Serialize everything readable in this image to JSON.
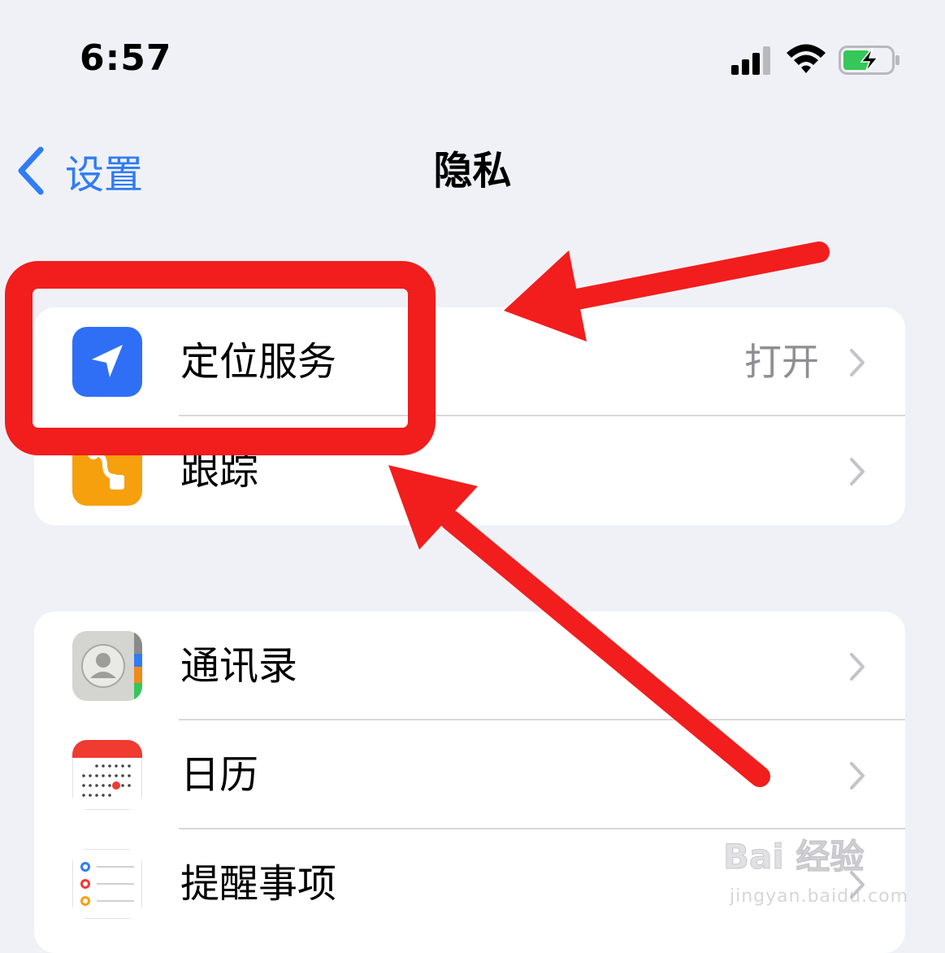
{
  "status_bar": {
    "time": "6:57"
  },
  "nav": {
    "back_label": "设置",
    "title": "隐私"
  },
  "groups": [
    {
      "rows": [
        {
          "label": "定位服务",
          "value": "打开",
          "icon": "location-arrow-icon"
        },
        {
          "label": "跟踪",
          "value": "",
          "icon": "tracking-icon"
        }
      ]
    },
    {
      "rows": [
        {
          "label": "通讯录",
          "icon": "contacts-icon"
        },
        {
          "label": "日历",
          "icon": "calendar-icon"
        },
        {
          "label": "提醒事项",
          "icon": "reminders-icon"
        }
      ]
    }
  ],
  "watermark": {
    "logo": "Bai 经验",
    "url": "jingyan.baidu.com"
  },
  "colors": {
    "accent": "#2f7cf6",
    "highlight": "#f21d1d",
    "location_icon": "#2f6ff5",
    "tracking_icon": "#f6a00e",
    "calendar_header": "#ef3b30"
  }
}
